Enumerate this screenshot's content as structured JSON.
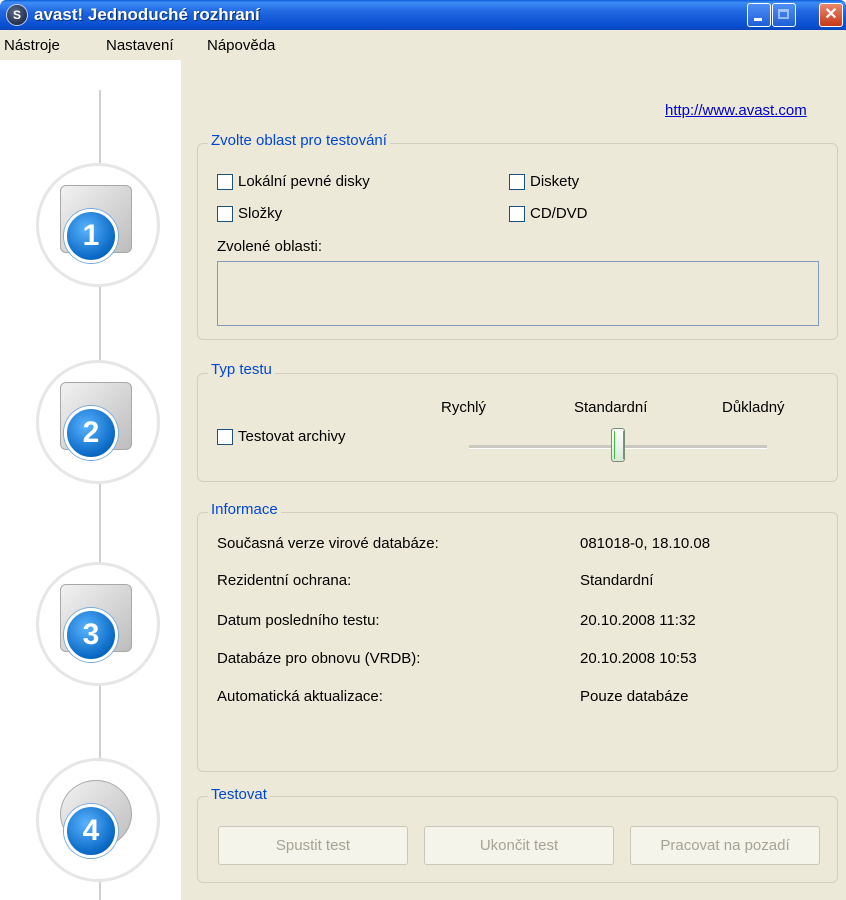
{
  "window": {
    "title": "avast! Jednoduché rozhraní",
    "app_icon": "avast-icon"
  },
  "menu": [
    "Nástroje",
    "Nastavení",
    "Nápověda"
  ],
  "link": "http://www.avast.com",
  "steps": [
    "1",
    "2",
    "3",
    "4"
  ],
  "area": {
    "legend": "Zvolte oblast pro testování",
    "checkboxes": [
      {
        "label": "Lokální pevné disky",
        "checked": false
      },
      {
        "label": "Diskety",
        "checked": false
      },
      {
        "label": "Složky",
        "checked": false
      },
      {
        "label": "CD/DVD",
        "checked": false
      }
    ],
    "selected_label": "Zvolené oblasti:"
  },
  "test_type": {
    "legend": "Typ testu",
    "archive_label": "Testovat archivy",
    "archive_checked": false,
    "levels": [
      "Rychlý",
      "Standardní",
      "Důkladný"
    ],
    "selected_level": "Standardní"
  },
  "info": {
    "legend": "Informace",
    "rows": [
      {
        "label": "Současná verze virové databáze:",
        "value": "081018-0, 18.10.08"
      },
      {
        "label": "Rezidentní ochrana:",
        "value": "Standardní"
      },
      {
        "label": "Datum posledního testu:",
        "value": "20.10.2008 11:32"
      },
      {
        "label": "Databáze pro obnovu (VRDB):",
        "value": "20.10.2008 10:53"
      },
      {
        "label": "Automatická aktualizace:",
        "value": "Pouze databáze"
      }
    ]
  },
  "scan": {
    "legend": "Testovat",
    "buttons": [
      "Spustit test",
      "Ukončit test",
      "Pracovat na pozadí"
    ]
  }
}
